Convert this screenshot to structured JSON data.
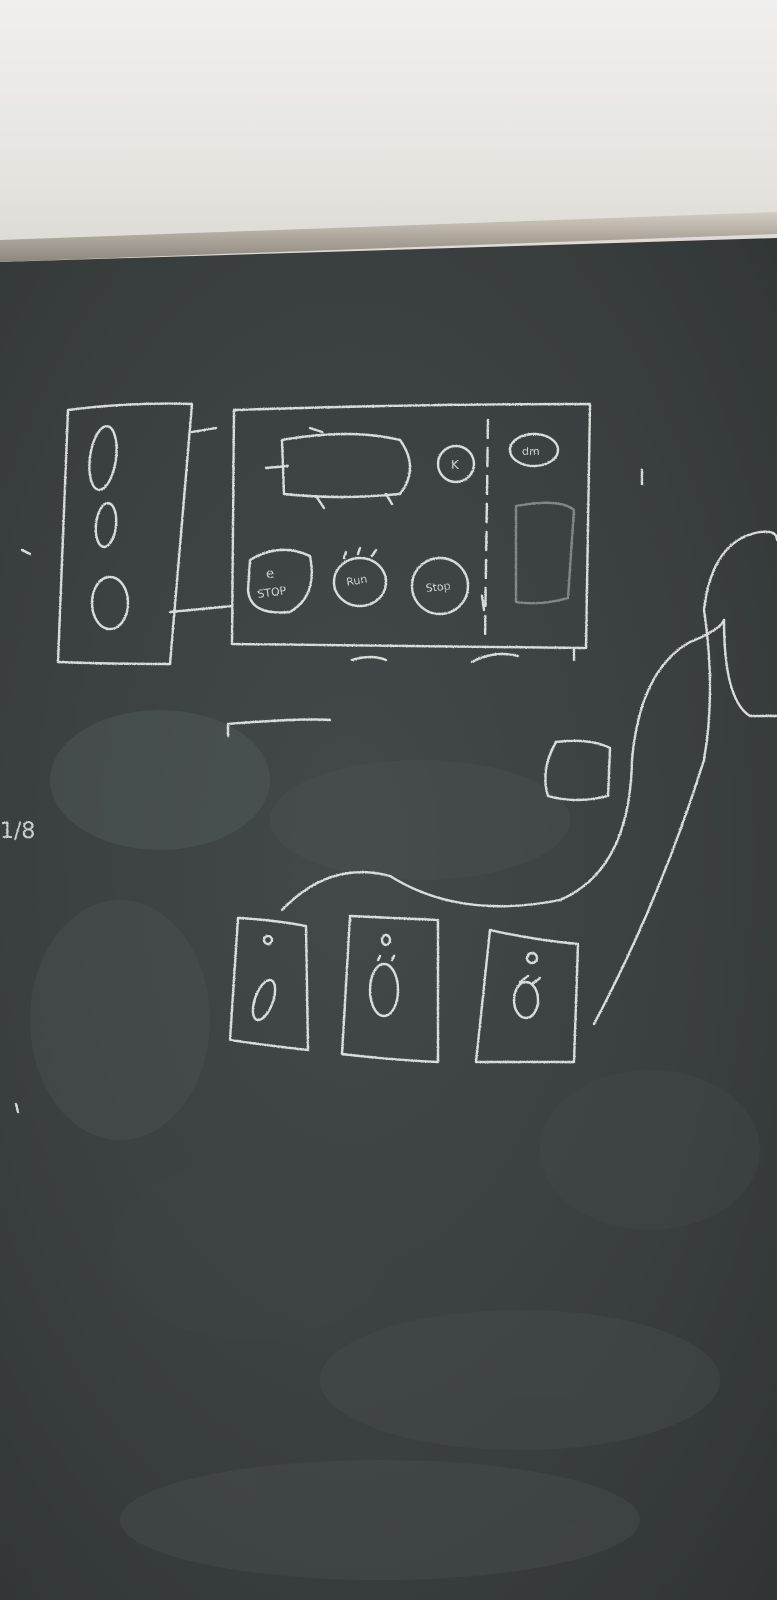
{
  "scene": {
    "description_colors": {
      "wall": "#ece9e5",
      "board": "#3b4040",
      "chalk": "#e6ebe8",
      "tray": "#b9b3aa"
    }
  },
  "labels": {
    "estop_top": "e",
    "estop_bottom": "STOP",
    "run_button": "Run",
    "stop_button": "Stop",
    "k_circle": "K",
    "corner_circle": "dm",
    "margin_mark": "1/8"
  }
}
